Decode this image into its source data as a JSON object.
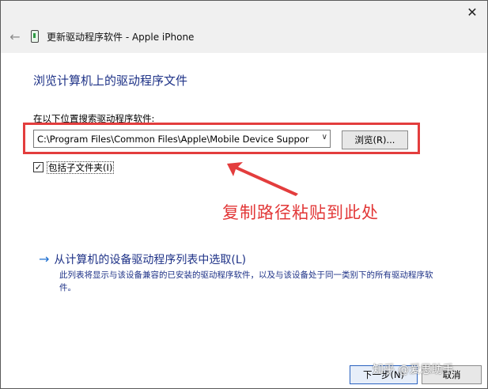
{
  "window": {
    "title": "更新驱动程序软件 - Apple iPhone",
    "close_glyph": "✕",
    "back_glyph": "←"
  },
  "heading": "浏览计算机上的驱动程序文件",
  "search": {
    "label": "在以下位置搜索驱动程序软件:",
    "path_value": "C:\\Program Files\\Common Files\\Apple\\Mobile Device Suppor",
    "dropdown_glyph": "∨",
    "browse_label": "浏览(R)..."
  },
  "include_subfolders": {
    "checked": true,
    "check_glyph": "✓",
    "label": "包括子文件夹(I)"
  },
  "annotation": {
    "text": "复制路径粘贴到此处",
    "color": "#e23838"
  },
  "pick_from_list": {
    "link_text": "从计算机的设备驱动程序列表中选取(L)",
    "arrow_glyph": "→",
    "description": "此列表将显示与该设备兼容的已安装的驱动程序软件，以及与该设备处于同一类别下的所有驱动程序软件。"
  },
  "footer": {
    "next_label": "下一步(N)",
    "cancel_label": "取消",
    "watermark": "知乎 @爱思助手"
  },
  "colors": {
    "heading_blue": "#1e3287",
    "highlight_red": "#e33d3d",
    "titlebar_bg": "#f0f0f0"
  }
}
